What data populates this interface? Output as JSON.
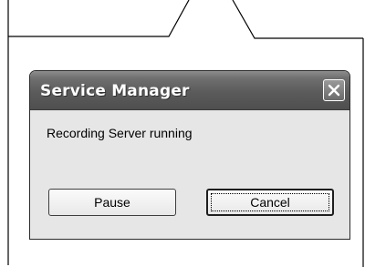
{
  "dialog": {
    "title": "Service Manager",
    "message": "Recording Server running",
    "close_icon": "close-icon",
    "buttons": {
      "pause_label": "Pause",
      "cancel_label": "Cancel"
    }
  },
  "colors": {
    "titlebar": "#5b5b5b",
    "dialog_background": "#e6e6e6",
    "page_background": "#ffffff"
  }
}
